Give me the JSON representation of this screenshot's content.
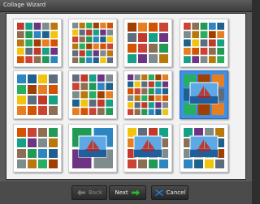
{
  "window": {
    "title": "Collage Wizard"
  },
  "templates": [
    {
      "id": "t1",
      "selected": false
    },
    {
      "id": "t2",
      "selected": false
    },
    {
      "id": "t3",
      "selected": false
    },
    {
      "id": "t4",
      "selected": false
    },
    {
      "id": "t5",
      "selected": false
    },
    {
      "id": "t6",
      "selected": false
    },
    {
      "id": "t7",
      "selected": false
    },
    {
      "id": "t8",
      "selected": true
    },
    {
      "id": "t9",
      "selected": false
    },
    {
      "id": "t10",
      "selected": false
    },
    {
      "id": "t11",
      "selected": false
    },
    {
      "id": "t12",
      "selected": false
    }
  ],
  "buttons": {
    "back": "Back",
    "next": "Next",
    "cancel": "Cancel",
    "back_icon": "arrow-left-icon",
    "next_icon": "arrow-right-icon",
    "cancel_icon": "close-icon"
  },
  "colors": {
    "selected_highlight": "#3f8fe6",
    "next_arrow": "#2dbb2d",
    "cancel_icon": "#2f7fe0"
  }
}
